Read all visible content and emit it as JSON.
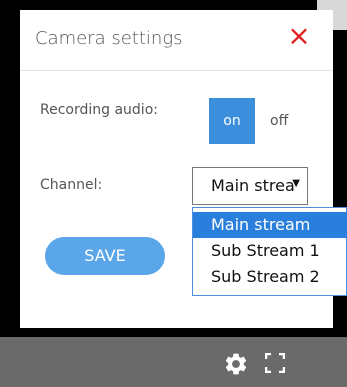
{
  "dialog": {
    "title": "Camera settings",
    "close_icon": "×",
    "recording_audio_label": "Recording audio:",
    "toggle_on_label": "on",
    "toggle_off_label": "off",
    "channel_label": "Channel:",
    "channel_selected_value": "Main stream",
    "channel_options": [
      {
        "label": "Main stream",
        "selected": true
      },
      {
        "label": "Sub Stream 1",
        "selected": false
      },
      {
        "label": "Sub Stream 2",
        "selected": false
      }
    ],
    "save_label": "SAVE"
  },
  "colors": {
    "accent": "#3a8edb",
    "save": "#5aa6e8",
    "close": "#e02020",
    "toolbar": "#6a6a6a"
  },
  "icons": {
    "close": "close-icon",
    "gear": "gear-icon",
    "fullscreen": "fullscreen-icon",
    "dropdown": "chevron-down-icon"
  }
}
